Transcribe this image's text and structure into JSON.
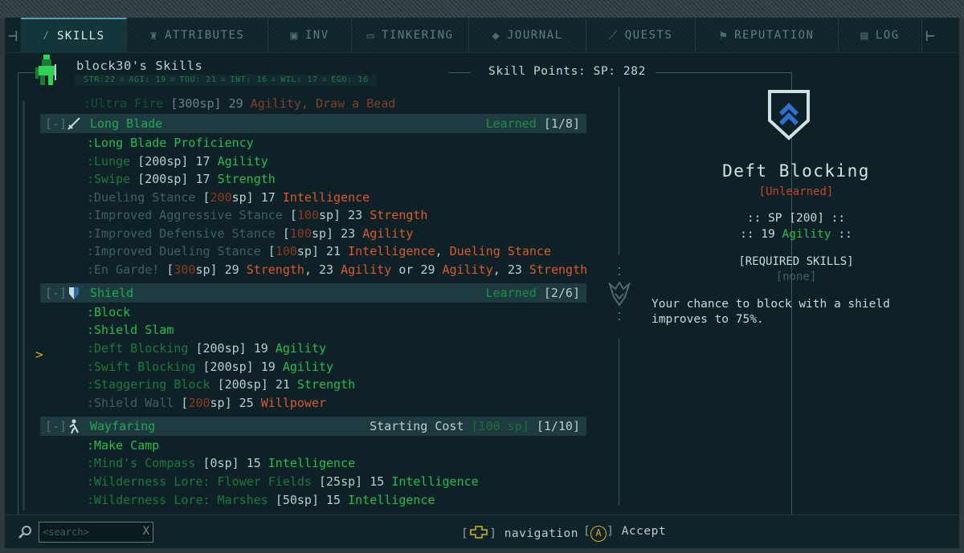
{
  "tabs": [
    {
      "label": "SKILLS",
      "icon": "sword-icon",
      "active": true
    },
    {
      "label": "ATTRIBUTES",
      "icon": "figure-icon"
    },
    {
      "label": "INV",
      "icon": "backpack-icon"
    },
    {
      "label": "TINKERING",
      "icon": "toolbox-icon"
    },
    {
      "label": "JOURNAL",
      "icon": "book-icon"
    },
    {
      "label": "QUESTS",
      "icon": "quill-icon"
    },
    {
      "label": "REPUTATION",
      "icon": "banner-icon"
    },
    {
      "label": "LOG",
      "icon": "scroll-icon"
    }
  ],
  "character": {
    "title": "block30's Skills",
    "stats": [
      "STR:22",
      "AGI: 19",
      "TOU: 21",
      "INT: 16",
      "WIL: 17",
      "EGO: 16"
    ]
  },
  "skill_points_label": "Skill Points: SP: 282",
  "partial_row": {
    "name": ":Ultra Fire",
    "cost": "[300sp]",
    "req": "29",
    "attr": "Agility",
    "extra": ", Draw a Bead"
  },
  "categories": [
    {
      "toggle": "[-]",
      "name": "Long Blade",
      "status": "Learned",
      "progress": "[1/8]"
    },
    {
      "toggle": "[-]",
      "name": "Shield",
      "status": "Learned",
      "progress": "[2/6]"
    },
    {
      "toggle": "[-]",
      "name": "Wayfaring",
      "status_prefix": "Starting Cost",
      "cost": "[100 sp]",
      "progress": "[1/10]"
    }
  ],
  "long_blade": [
    {
      "name": ":Long Blade Proficiency"
    },
    {
      "name": ":Lunge",
      "cost": "[200sp]",
      "req": "17",
      "attr": "Agility"
    },
    {
      "name": ":Swipe",
      "cost": "[200sp]",
      "req": "17",
      "attr": "Strength"
    },
    {
      "name": ":Dueling Stance",
      "cost_lb": "[",
      "cost_n": "200",
      "cost_rb": "sp]",
      "req": "17",
      "attr": "Intelligence"
    },
    {
      "name": ":Improved Aggressive Stance",
      "cost_lb": "[",
      "cost_n": "100",
      "cost_rb": "sp]",
      "req": "23",
      "attr": "Strength"
    },
    {
      "name": ":Improved Defensive Stance",
      "cost_lb": "[",
      "cost_n": "100",
      "cost_rb": "sp]",
      "req": "23",
      "attr": "Agility"
    },
    {
      "name": ":Improved Dueling Stance",
      "cost_lb": "[",
      "cost_n": "100",
      "cost_rb": "sp]",
      "req": "21",
      "attr": "Intelligence",
      "extra_sep": ",",
      "extra": "Dueling Stance"
    },
    {
      "name": ":En Garde!",
      "cost_lb": "[",
      "cost_n": "300",
      "cost_rb": "sp]",
      "req": "29",
      "attr": "Strength",
      "sep1": ",",
      "req2": "23",
      "attr2": "Agility",
      "or": "or",
      "req3": "29",
      "attr3": "Agility",
      "sep2": ",",
      "req4": "23",
      "attr4": "Strength"
    }
  ],
  "shield": [
    {
      "name": ":Block"
    },
    {
      "name": ":Shield Slam"
    },
    {
      "name": ":Deft Blocking",
      "cost": "[200sp]",
      "req": "19",
      "attr": "Agility"
    },
    {
      "name": ":Swift Blocking",
      "cost": "[200sp]",
      "req": "19",
      "attr": "Agility"
    },
    {
      "name": ":Staggering Block",
      "cost": "[200sp]",
      "req": "21",
      "attr": "Strength"
    },
    {
      "name": ":Shield Wall",
      "cost_lb": "[",
      "cost_n": "200",
      "cost_rb": "sp]",
      "req": "25",
      "attr": "Willpower"
    }
  ],
  "wayfaring": [
    {
      "name": ":Make Camp"
    },
    {
      "name": ":Mind's Compass",
      "cost": "[0sp]",
      "req": "15",
      "attr": "Intelligence"
    },
    {
      "name": ":Wilderness Lore: Flower Fields",
      "cost": "[25sp]",
      "req": "15",
      "attr": "Intelligence"
    },
    {
      "name": ":Wilderness Lore: Marshes",
      "cost": "[50sp]",
      "req": "15",
      "attr": "Intelligence"
    }
  ],
  "cursor": ">",
  "detail": {
    "name": "Deft Blocking",
    "status": "[Unlearned]",
    "sp_line": ":: SP [200] ::",
    "req_num": ":: 19",
    "req_attr": "Agility",
    "req_end": "::",
    "required_header": "[REQUIRED SKILLS]",
    "required_value": "[none]",
    "description": "Your chance to block with a shield improves to 75%."
  },
  "bottom": {
    "search_placeholder": "<search>",
    "search_clear": "X",
    "nav_bracket_l": "[",
    "nav_bracket_r": "]",
    "nav_label": "navigation",
    "accept_bracket_l": "[",
    "accept_key": "A",
    "accept_bracket_r": "]",
    "accept_label": "Accept"
  },
  "colors": {
    "learned_green": "#26bd4e",
    "requirement_orange": "#dc5a2c",
    "accent_blue": "#3ea4c8",
    "cursor_yellow": "#d4b021"
  }
}
